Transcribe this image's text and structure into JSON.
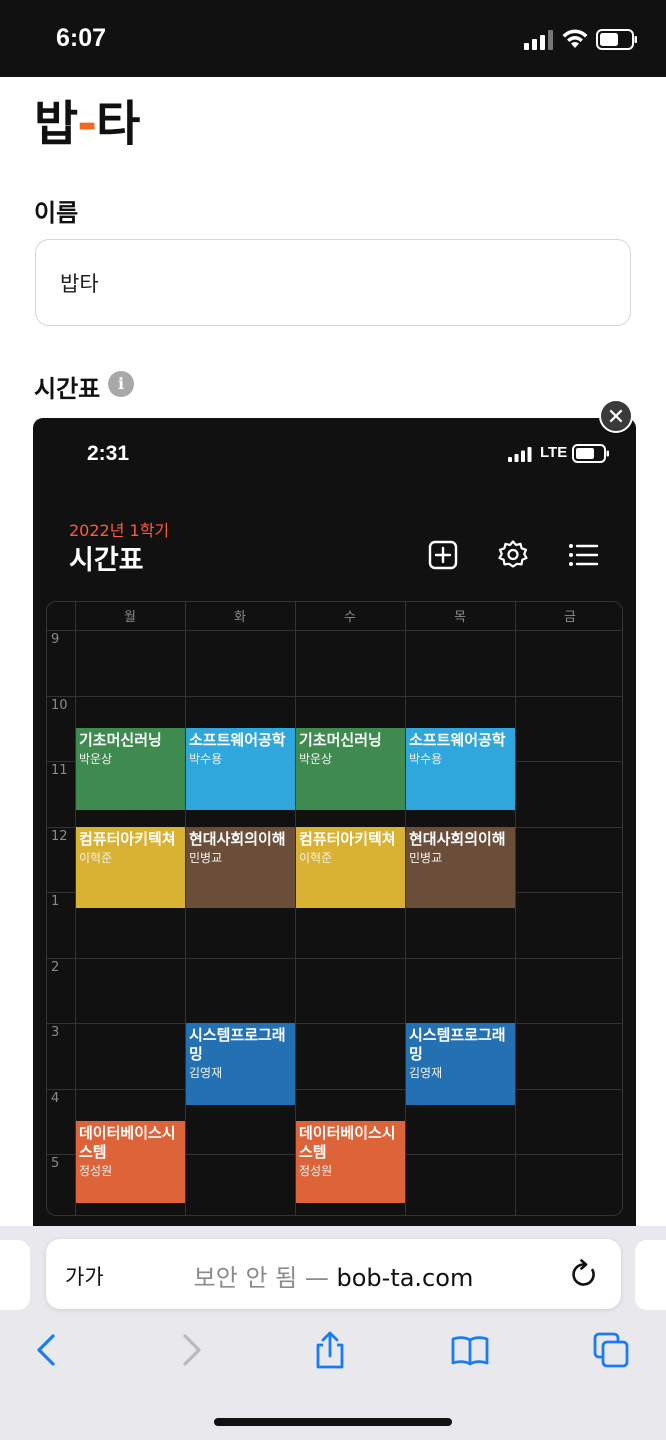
{
  "status_bar": {
    "time": "6:07"
  },
  "page": {
    "logo_left": "밥",
    "logo_dash": "-",
    "logo_right": "타",
    "name_label": "이름",
    "name_value": "밥타",
    "timetable_label": "시간표",
    "info_icon_glyph": "i",
    "close_glyph": "✕"
  },
  "screenshot": {
    "time": "2:31",
    "network": "LTE",
    "semester": "2022년 1학기",
    "title": "시간표",
    "days": [
      "월",
      "화",
      "수",
      "목",
      "금"
    ],
    "hours": [
      "9",
      "10",
      "11",
      "12",
      "1",
      "2",
      "3",
      "4",
      "5"
    ],
    "courses": [
      {
        "name": "기초머신러닝",
        "prof": "박운상",
        "day": 0,
        "start": 10.5,
        "end": 11.75,
        "color": "#3f8a4f"
      },
      {
        "name": "소프트웨어공학",
        "prof": "박수용",
        "day": 1,
        "start": 10.5,
        "end": 11.75,
        "color": "#2fa7dd"
      },
      {
        "name": "기초머신러닝",
        "prof": "박운상",
        "day": 2,
        "start": 10.5,
        "end": 11.75,
        "color": "#3f8a4f"
      },
      {
        "name": "소프트웨어공학",
        "prof": "박수용",
        "day": 3,
        "start": 10.5,
        "end": 11.75,
        "color": "#2fa7dd"
      },
      {
        "name": "컴퓨터아키텍쳐",
        "prof": "이혁준",
        "day": 0,
        "start": 12.0,
        "end": 13.25,
        "color": "#d9b234"
      },
      {
        "name": "현대사회의이해",
        "prof": "민병교",
        "day": 1,
        "start": 12.0,
        "end": 13.25,
        "color": "#6b4e3a"
      },
      {
        "name": "컴퓨터아키텍쳐",
        "prof": "이혁준",
        "day": 2,
        "start": 12.0,
        "end": 13.25,
        "color": "#d9b234"
      },
      {
        "name": "현대사회의이해",
        "prof": "민병교",
        "day": 3,
        "start": 12.0,
        "end": 13.25,
        "color": "#6b4e3a"
      },
      {
        "name": "시스템프로그래밍",
        "prof": "김영재",
        "day": 1,
        "start": 15.0,
        "end": 16.25,
        "color": "#2370b2"
      },
      {
        "name": "시스템프로그래밍",
        "prof": "김영재",
        "day": 3,
        "start": 15.0,
        "end": 16.25,
        "color": "#2370b2"
      },
      {
        "name": "데이터베이스시스템",
        "prof": "정성원",
        "day": 0,
        "start": 16.5,
        "end": 17.75,
        "color": "#dd6338"
      },
      {
        "name": "데이터베이스시스템",
        "prof": "정성원",
        "day": 2,
        "start": 16.5,
        "end": 17.75,
        "color": "#dd6338"
      }
    ]
  },
  "safari": {
    "aa": "가가",
    "insecure_label": "보안 안 됨",
    "separator": " — ",
    "domain": "bob-ta.com"
  },
  "icons": {
    "toolbar": [
      "back-icon",
      "forward-icon",
      "share-icon",
      "bookmarks-icon",
      "tabs-icon"
    ],
    "app": [
      "add-icon",
      "settings-icon",
      "list-icon"
    ]
  },
  "colors": {
    "accent": "#f26a21",
    "safari_blue": "#1a7cf5",
    "semester_red": "#ff5a3c"
  }
}
